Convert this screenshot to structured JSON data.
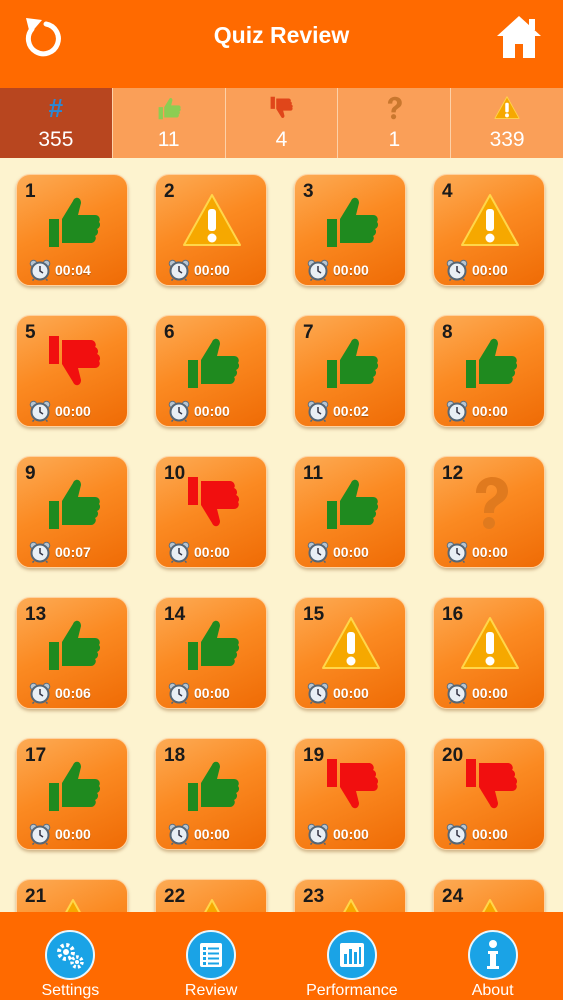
{
  "header": {
    "title": "Quiz Review"
  },
  "stats": [
    {
      "icon": "hash-icon",
      "count": "355"
    },
    {
      "icon": "thumbs-up-icon",
      "count": "11"
    },
    {
      "icon": "thumbs-down-icon",
      "count": "4"
    },
    {
      "icon": "question-icon",
      "count": "1"
    },
    {
      "icon": "warning-icon",
      "count": "339"
    }
  ],
  "tiles": [
    {
      "number": "1",
      "result": "correct",
      "time": "00:04"
    },
    {
      "number": "2",
      "result": "unanswered",
      "time": "00:00"
    },
    {
      "number": "3",
      "result": "correct",
      "time": "00:00"
    },
    {
      "number": "4",
      "result": "unanswered",
      "time": "00:00"
    },
    {
      "number": "5",
      "result": "incorrect",
      "time": "00:00"
    },
    {
      "number": "6",
      "result": "correct",
      "time": "00:00"
    },
    {
      "number": "7",
      "result": "correct",
      "time": "00:02"
    },
    {
      "number": "8",
      "result": "correct",
      "time": "00:00"
    },
    {
      "number": "9",
      "result": "correct",
      "time": "00:07"
    },
    {
      "number": "10",
      "result": "incorrect",
      "time": "00:00"
    },
    {
      "number": "11",
      "result": "correct",
      "time": "00:00"
    },
    {
      "number": "12",
      "result": "skipped",
      "time": "00:00"
    },
    {
      "number": "13",
      "result": "correct",
      "time": "00:06"
    },
    {
      "number": "14",
      "result": "correct",
      "time": "00:00"
    },
    {
      "number": "15",
      "result": "unanswered",
      "time": "00:00"
    },
    {
      "number": "16",
      "result": "unanswered",
      "time": "00:00"
    },
    {
      "number": "17",
      "result": "correct",
      "time": "00:00"
    },
    {
      "number": "18",
      "result": "correct",
      "time": "00:00"
    },
    {
      "number": "19",
      "result": "incorrect",
      "time": "00:00"
    },
    {
      "number": "20",
      "result": "incorrect",
      "time": "00:00"
    },
    {
      "number": "21",
      "result": "unanswered",
      "time": ""
    },
    {
      "number": "22",
      "result": "unanswered",
      "time": ""
    },
    {
      "number": "23",
      "result": "unanswered",
      "time": ""
    },
    {
      "number": "24",
      "result": "unanswered",
      "time": ""
    }
  ],
  "tabs": [
    {
      "label": "Settings",
      "icon": "gears-icon"
    },
    {
      "label": "Review",
      "icon": "list-icon"
    },
    {
      "label": "Performance",
      "icon": "bar-chart-icon"
    },
    {
      "label": "About",
      "icon": "info-icon"
    }
  ],
  "colors": {
    "accent": "#ff6a00",
    "background": "#fdf3cf",
    "correct": "#1f8a1f",
    "incorrect": "#f10f0f",
    "skipped": "#e07a1e",
    "warning": "#f6a800",
    "tab_icon": "#1aa3e6"
  }
}
